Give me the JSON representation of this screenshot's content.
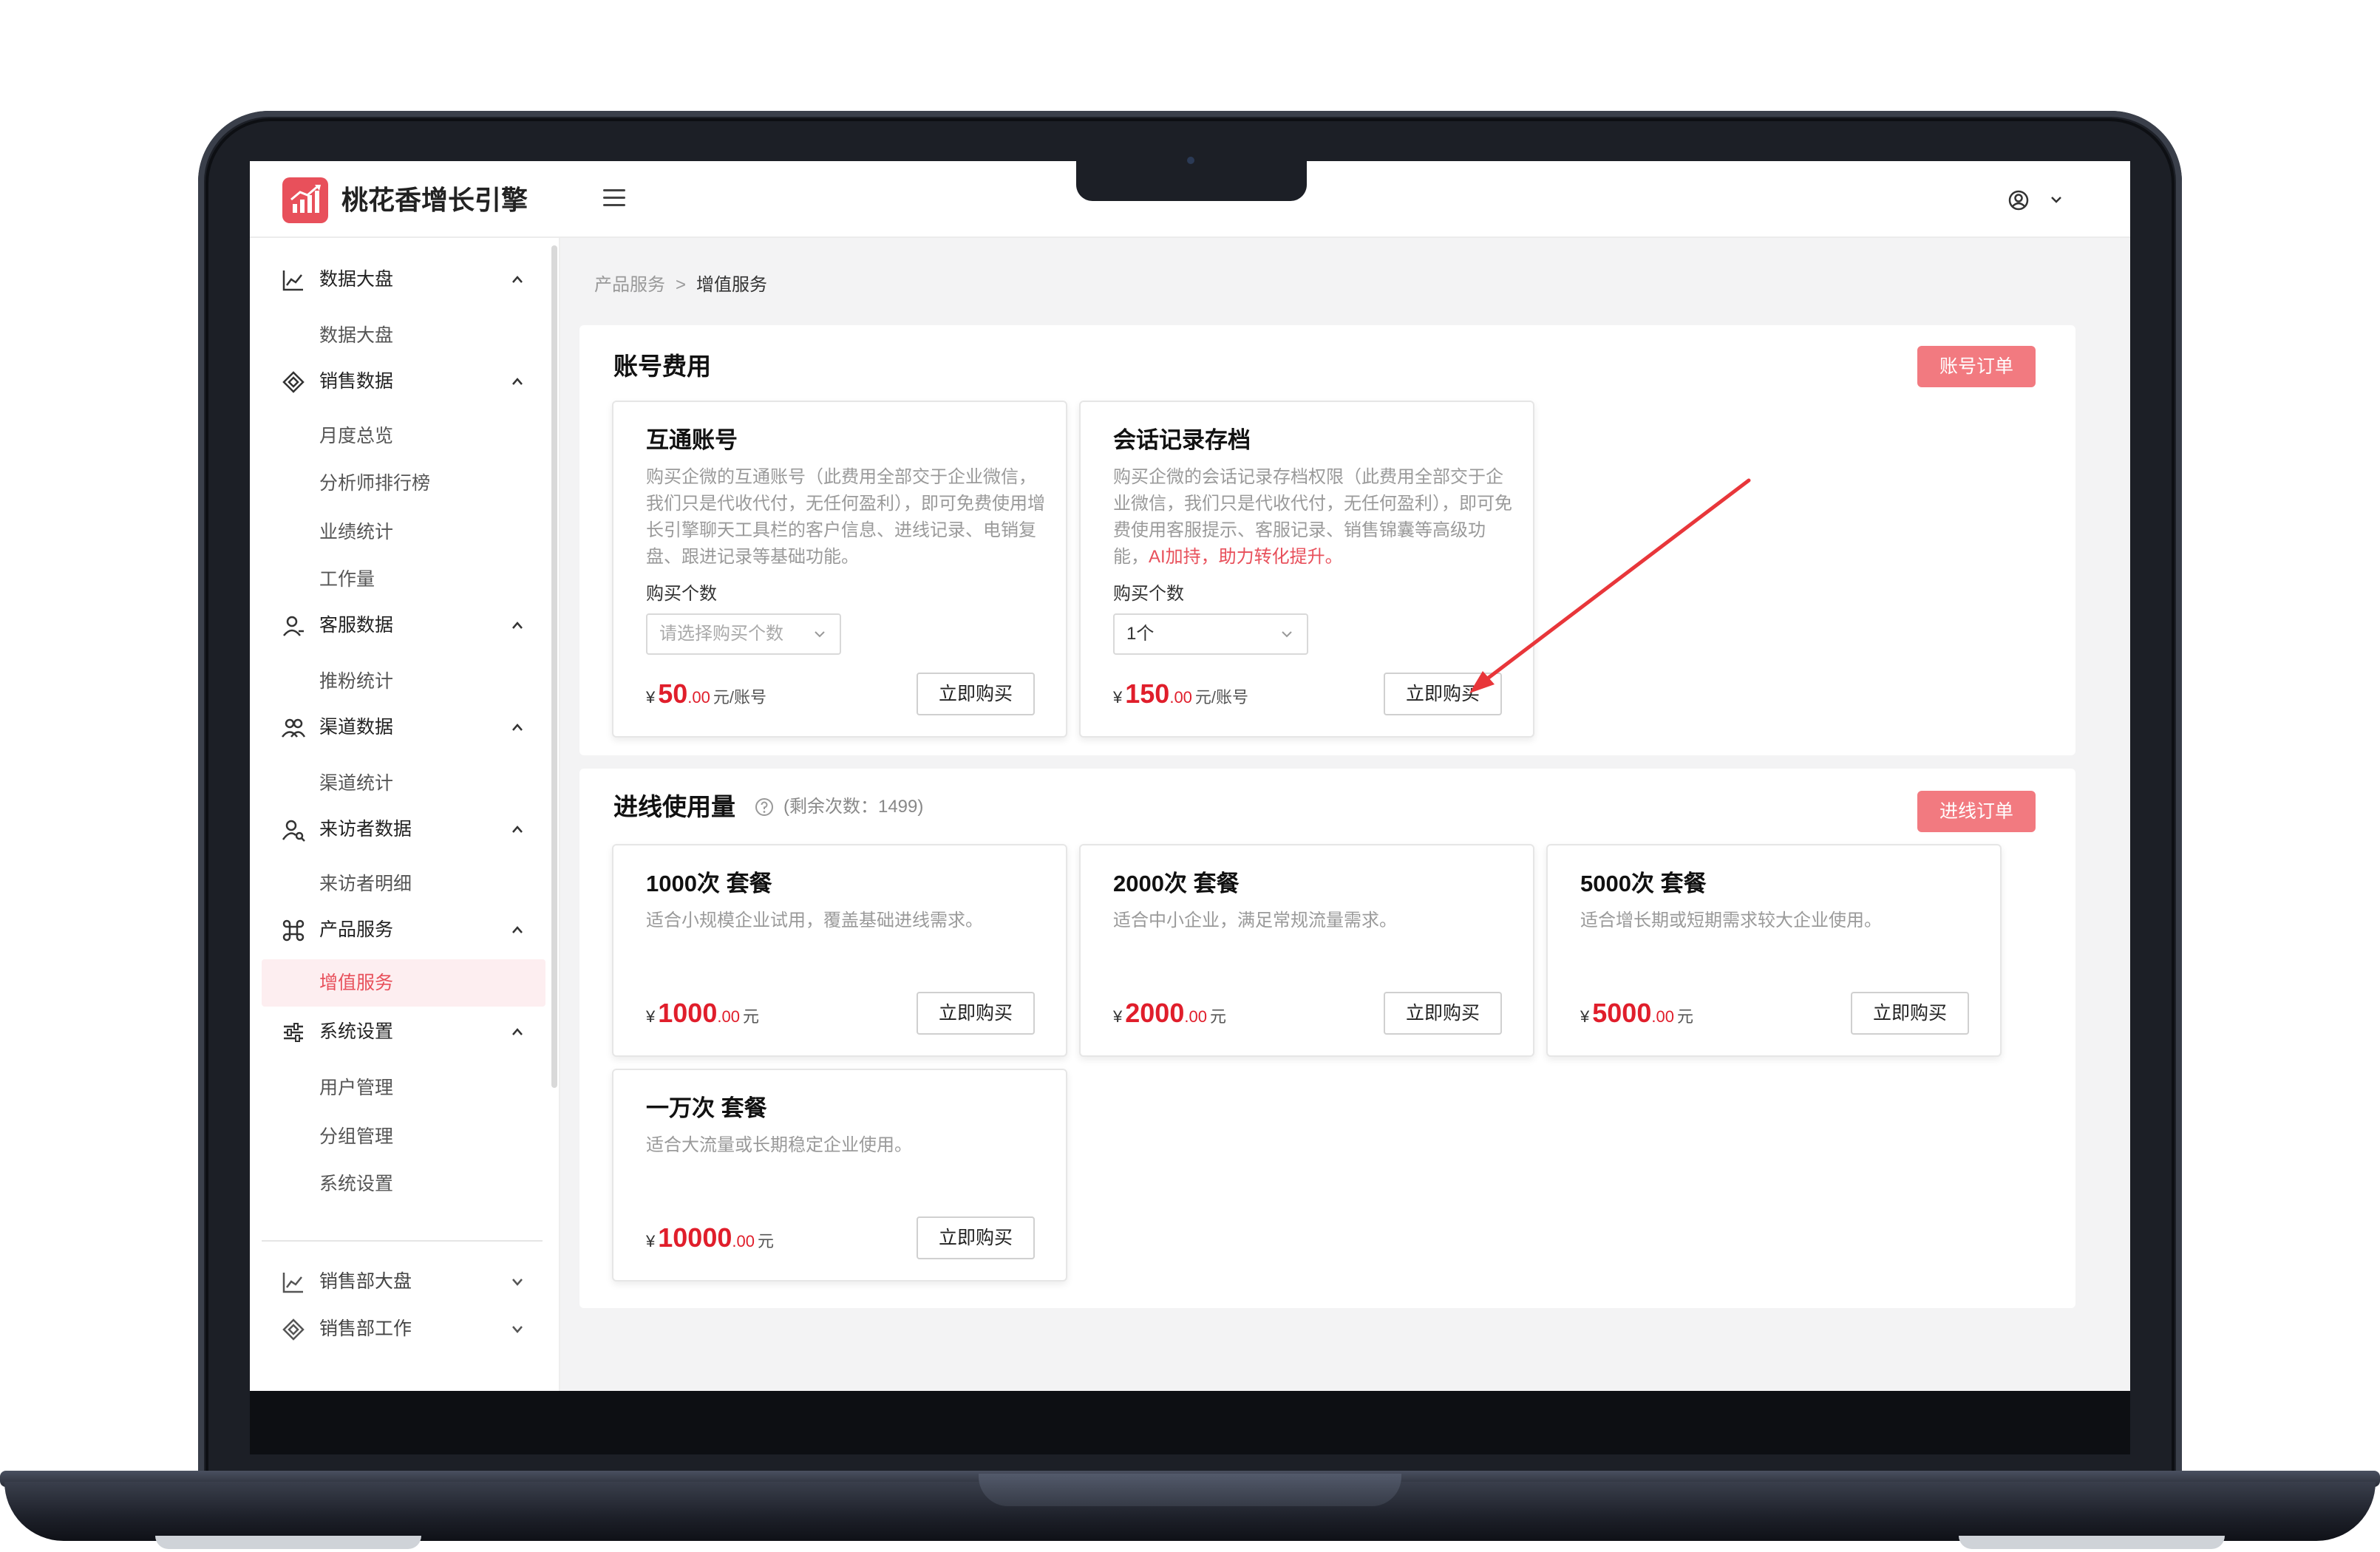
{
  "app": {
    "title": "桃花香增长引擎"
  },
  "sidebar": {
    "groups": [
      {
        "label": "数据大盘",
        "icon": "line-chart-icon",
        "items": [
          "数据大盘"
        ]
      },
      {
        "label": "销售数据",
        "icon": "diamond-tag-icon",
        "items": [
          "月度总览",
          "分析师排行榜",
          "业绩统计",
          "工作量"
        ]
      },
      {
        "label": "客服数据",
        "icon": "user-headset-icon",
        "items": [
          "推粉统计"
        ]
      },
      {
        "label": "渠道数据",
        "icon": "users-icon",
        "items": [
          "渠道统计"
        ]
      },
      {
        "label": "来访者数据",
        "icon": "user-search-icon",
        "items": [
          "来访者明细"
        ]
      },
      {
        "label": "产品服务",
        "icon": "command-icon",
        "items": [
          "增值服务"
        ]
      },
      {
        "label": "系统设置",
        "icon": "sliders-icon",
        "items": [
          "用户管理",
          "分组管理",
          "系统设置"
        ]
      }
    ],
    "extra_groups": [
      {
        "label": "销售部大盘",
        "icon": "line-chart-icon"
      },
      {
        "label": "销售部工作",
        "icon": "diamond-tag-icon"
      }
    ],
    "active_item": "增值服务"
  },
  "breadcrumb": {
    "parent": "产品服务",
    "separator": ">",
    "current": "增值服务"
  },
  "account_section": {
    "title": "账号费用",
    "order_button": "账号订单",
    "cards": [
      {
        "title": "互通账号",
        "description": "购买企微的互通账号（此费用全部交于企业微信，我们只是代收代付，无任何盈利），即可免费使用增长引擎聊天工具栏的客户信息、进线记录、电销复盘、跟进记录等基础功能。",
        "qty_label": "购买个数",
        "qty_placeholder": "请选择购买个数",
        "qty_value": "",
        "currency": "¥",
        "price_int": "50",
        "price_dec": ".00",
        "unit": "元/账号",
        "buy_label": "立即购买"
      },
      {
        "title": "会话记录存档",
        "description": "购买企微的会话记录存档权限（此费用全部交于企业微信，我们只是代收代付，无任何盈利），即可免费使用客服提示、客服记录、销售锦囊等高级功能，",
        "description_highlight": "AI加持，助力转化提升。",
        "qty_label": "购买个数",
        "qty_placeholder": "",
        "qty_value": "1个",
        "currency": "¥",
        "price_int": "150",
        "price_dec": ".00",
        "unit": "元/账号",
        "buy_label": "立即购买"
      }
    ]
  },
  "inbound_section": {
    "title": "进线使用量",
    "remaining": "(剩余次数：1499)",
    "order_button": "进线订单",
    "cards": [
      {
        "title": "1000次 套餐",
        "description": "适合小规模企业试用，覆盖基础进线需求。",
        "currency": "¥",
        "price_int": "1000",
        "price_dec": ".00",
        "unit": "元",
        "buy_label": "立即购买"
      },
      {
        "title": "2000次 套餐",
        "description": "适合中小企业，满足常规流量需求。",
        "currency": "¥",
        "price_int": "2000",
        "price_dec": ".00",
        "unit": "元",
        "buy_label": "立即购买"
      },
      {
        "title": "5000次 套餐",
        "description": "适合增长期或短期需求较大企业使用。",
        "currency": "¥",
        "price_int": "5000",
        "price_dec": ".00",
        "unit": "元",
        "buy_label": "立即购买"
      },
      {
        "title": "一万次 套餐",
        "description": "适合大流量或长期稳定企业使用。",
        "currency": "¥",
        "price_int": "10000",
        "price_dec": ".00",
        "unit": "元",
        "buy_label": "立即购买"
      }
    ]
  },
  "colors": {
    "accent": "#e8505b",
    "price": "#e01e2b",
    "order_button": "#f27a80",
    "annotation_arrow": "#e8363a"
  }
}
